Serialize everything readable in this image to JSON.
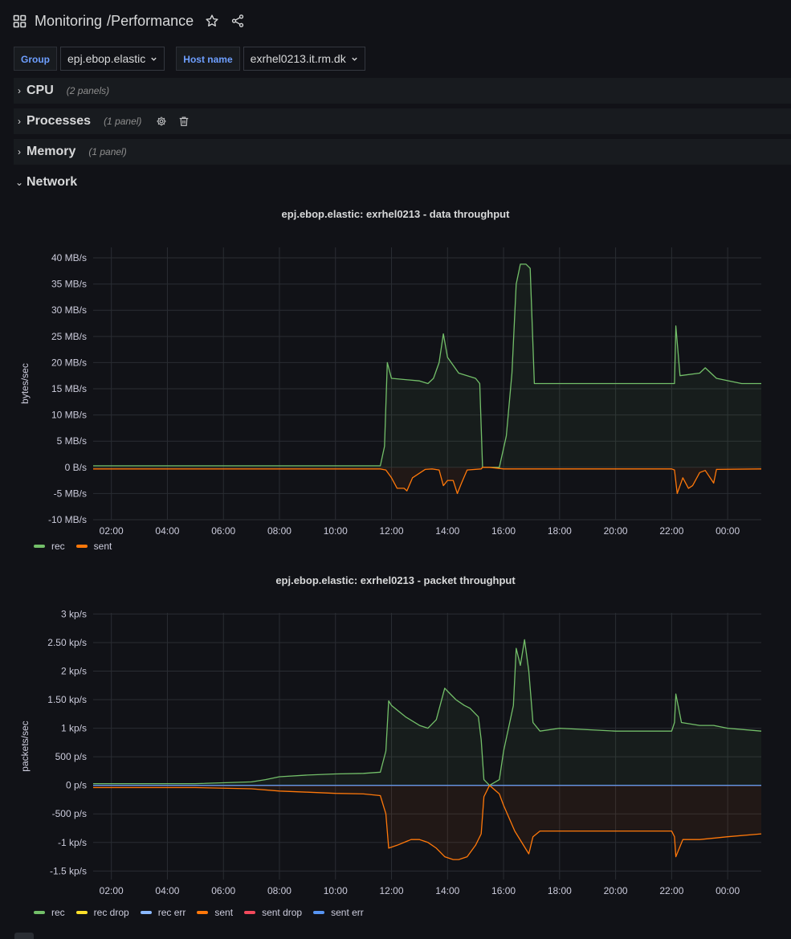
{
  "header": {
    "folder": "Monitoring",
    "separator": "/",
    "title": "Performance",
    "icons": [
      "dashboards-grid-icon",
      "star-icon",
      "share-icon"
    ]
  },
  "variables": [
    {
      "label": "Group",
      "value": "epj.ebop.elastic"
    },
    {
      "label": "Host name",
      "value": "exrhel0213.it.rm.dk"
    }
  ],
  "rows": [
    {
      "title": "CPU",
      "count": "(2 panels)",
      "collapsed": true
    },
    {
      "title": "Processes",
      "count": "(1 panel)",
      "collapsed": true
    },
    {
      "title": "Memory",
      "count": "(1 panel)",
      "collapsed": true
    },
    {
      "title": "Network",
      "count": "",
      "collapsed": false
    }
  ],
  "colors": {
    "background": "#111217",
    "rec": "#73bf69",
    "sent": "#ff780a",
    "rec_drop": "#fade2a",
    "rec_err": "#8ab8ff",
    "sent_drop": "#f2495c",
    "sent_err": "#5794f2",
    "grid": "#2a2d33"
  },
  "chart_data": [
    {
      "type": "area",
      "title": "epj.ebop.elastic: exrhel0213 - data throughput",
      "ylabel": "bytes/sec",
      "yunit": "MB/s",
      "ylim": [
        -10,
        42
      ],
      "yticks": [
        "40 MB/s",
        "35 MB/s",
        "30 MB/s",
        "25 MB/s",
        "20 MB/s",
        "15 MB/s",
        "10 MB/s",
        "5 MB/s",
        "0 B/s",
        "-5 MB/s",
        "-10 MB/s"
      ],
      "ytick_values": [
        40,
        35,
        30,
        25,
        20,
        15,
        10,
        5,
        0,
        -5,
        -10
      ],
      "xticks": [
        "02:00",
        "04:00",
        "06:00",
        "08:00",
        "10:00",
        "12:00",
        "14:00",
        "16:00",
        "18:00",
        "20:00",
        "22:00",
        "00:00"
      ],
      "xlim": [
        1.35,
        25.2
      ],
      "legend": "bottom-left",
      "series": [
        {
          "name": "rec",
          "color": "#73bf69",
          "x": [
            1.35,
            11.6,
            11.75,
            11.85,
            12.0,
            13.0,
            13.3,
            13.5,
            13.7,
            13.85,
            14.0,
            14.4,
            15.0,
            15.15,
            15.25,
            15.5,
            15.85,
            16.1,
            16.3,
            16.45,
            16.6,
            16.8,
            16.95,
            17.1,
            22.0,
            22.1,
            22.15,
            22.3,
            23.0,
            23.2,
            23.6,
            24.5,
            25.2
          ],
          "y": [
            0.3,
            0.3,
            4,
            20,
            17,
            16.5,
            16,
            17,
            20,
            25.5,
            21,
            18,
            17,
            16,
            0,
            0,
            0,
            6,
            18,
            35,
            38.8,
            38.8,
            38,
            16,
            16,
            16,
            27,
            17.5,
            18,
            19,
            17,
            16,
            16
          ]
        },
        {
          "name": "sent",
          "color": "#ff780a",
          "x": [
            1.35,
            11.6,
            11.8,
            12.0,
            12.2,
            12.45,
            12.55,
            12.75,
            13.2,
            13.45,
            13.7,
            13.85,
            14.0,
            14.2,
            14.35,
            14.5,
            14.7,
            15.2,
            15.25,
            15.5,
            16.0,
            16.5,
            22.0,
            22.1,
            22.2,
            22.4,
            22.6,
            22.75,
            23.0,
            23.2,
            23.5,
            23.6,
            25.2
          ],
          "y": [
            -0.3,
            -0.3,
            -0.5,
            -2,
            -4,
            -4,
            -4.5,
            -2,
            -0.4,
            -0.3,
            -0.5,
            -3.5,
            -2.5,
            -2.5,
            -5,
            -3,
            -0.5,
            -0.3,
            0,
            0,
            -0.3,
            -0.3,
            -0.3,
            -0.5,
            -5,
            -2,
            -4,
            -3.5,
            -1,
            -0.6,
            -3,
            -0.4,
            -0.3
          ]
        }
      ]
    },
    {
      "type": "area",
      "title": "epj.ebop.elastic: exrhel0213 - packet throughput",
      "ylabel": "packets/sec",
      "yunit": "p/s",
      "ylim": [
        -1650,
        3020
      ],
      "yticks": [
        "3 kp/s",
        "2.50 kp/s",
        "2 kp/s",
        "1.50 kp/s",
        "1 kp/s",
        "500 p/s",
        "0 p/s",
        "-500 p/s",
        "-1 kp/s",
        "-1.5 kp/s"
      ],
      "ytick_values": [
        3000,
        2500,
        2000,
        1500,
        1000,
        500,
        0,
        -500,
        -1000,
        -1500
      ],
      "xticks": [
        "02:00",
        "04:00",
        "06:00",
        "08:00",
        "10:00",
        "12:00",
        "14:00",
        "16:00",
        "18:00",
        "20:00",
        "22:00",
        "00:00"
      ],
      "xlim": [
        1.35,
        25.2
      ],
      "legend": "bottom-left",
      "series": [
        {
          "name": "rec",
          "color": "#73bf69",
          "x": [
            1.35,
            5.0,
            7.0,
            7.5,
            8.0,
            9.0,
            10.0,
            11.0,
            11.6,
            11.8,
            11.9,
            12.0,
            12.5,
            13.0,
            13.3,
            13.6,
            13.9,
            14.1,
            14.3,
            14.6,
            14.8,
            15.1,
            15.2,
            15.3,
            15.5,
            15.85,
            16.0,
            16.35,
            16.45,
            16.6,
            16.75,
            16.9,
            17.05,
            17.3,
            18.0,
            20.0,
            22.0,
            22.1,
            22.15,
            22.35,
            23.0,
            23.5,
            24.0,
            25.2
          ],
          "y": [
            30,
            30,
            60,
            100,
            150,
            180,
            200,
            210,
            230,
            600,
            1480,
            1400,
            1200,
            1050,
            1000,
            1150,
            1700,
            1600,
            1500,
            1400,
            1350,
            1200,
            800,
            100,
            0,
            100,
            600,
            1400,
            2400,
            2100,
            2550,
            2000,
            1100,
            950,
            1000,
            950,
            950,
            1100,
            1600,
            1100,
            1050,
            1050,
            1000,
            950
          ]
        },
        {
          "name": "sent",
          "color": "#ff780a",
          "x": [
            1.35,
            5.0,
            7.0,
            8.0,
            9.0,
            10.0,
            11.0,
            11.6,
            11.8,
            11.9,
            12.2,
            12.7,
            13.0,
            13.3,
            13.6,
            13.9,
            14.2,
            14.4,
            14.7,
            15.0,
            15.2,
            15.3,
            15.5,
            15.85,
            16.0,
            16.4,
            16.9,
            17.05,
            17.3,
            18.0,
            20.0,
            22.0,
            22.1,
            22.15,
            22.4,
            23.0,
            24.0,
            25.2
          ],
          "y": [
            -40,
            -40,
            -60,
            -100,
            -120,
            -140,
            -150,
            -180,
            -500,
            -1100,
            -1050,
            -950,
            -950,
            -1000,
            -1100,
            -1250,
            -1300,
            -1300,
            -1250,
            -1050,
            -850,
            -200,
            0,
            -150,
            -350,
            -800,
            -1200,
            -900,
            -800,
            -800,
            -800,
            -800,
            -900,
            -1250,
            -950,
            -950,
            -900,
            -850
          ]
        },
        {
          "name": "rec drop",
          "color": "#fade2a",
          "x": [
            1.35,
            25.2
          ],
          "y": [
            0,
            0
          ]
        },
        {
          "name": "rec err",
          "color": "#8ab8ff",
          "x": [
            1.35,
            25.2
          ],
          "y": [
            0,
            0
          ]
        },
        {
          "name": "sent drop",
          "color": "#f2495c",
          "x": [
            1.35,
            25.2
          ],
          "y": [
            0,
            0
          ]
        },
        {
          "name": "sent err",
          "color": "#5794f2",
          "x": [
            1.35,
            25.2
          ],
          "y": [
            0,
            0
          ]
        }
      ]
    }
  ]
}
